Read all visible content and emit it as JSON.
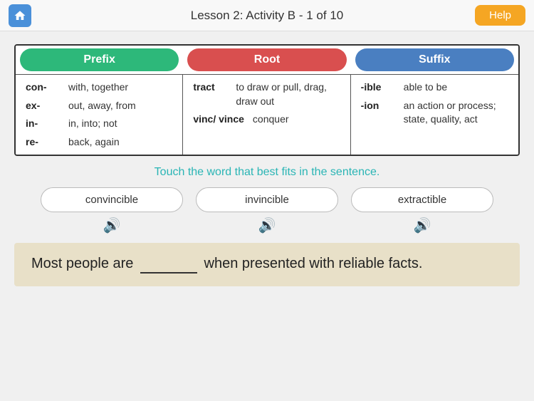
{
  "header": {
    "title": "Lesson 2:  Activity B - 1 of 10",
    "help_label": "Help"
  },
  "reference_table": {
    "prefix_header": "Prefix",
    "root_header": "Root",
    "suffix_header": "Suffix",
    "prefix_items": [
      {
        "key": "con-",
        "val": "with, together"
      },
      {
        "key": "ex-",
        "val": "out, away, from"
      },
      {
        "key": "in-",
        "val": "in, into; not"
      },
      {
        "key": "re-",
        "val": "back, again"
      }
    ],
    "root_items": [
      {
        "key": "tract",
        "val": "to draw or pull, drag, draw out"
      },
      {
        "key": "vinc/ vince",
        "val": "conquer"
      }
    ],
    "suffix_items": [
      {
        "key": "-ible",
        "val": "able to be"
      },
      {
        "key": "-ion",
        "val": "an action or process; state, quality, act"
      }
    ]
  },
  "instruction": "Touch the word that best fits in the sentence.",
  "choices": [
    {
      "label": "convincible"
    },
    {
      "label": "invincible"
    },
    {
      "label": "extractible"
    }
  ],
  "sentence": {
    "before": "Most people are ",
    "blank": "________",
    "after": " when presented with reliable facts."
  }
}
